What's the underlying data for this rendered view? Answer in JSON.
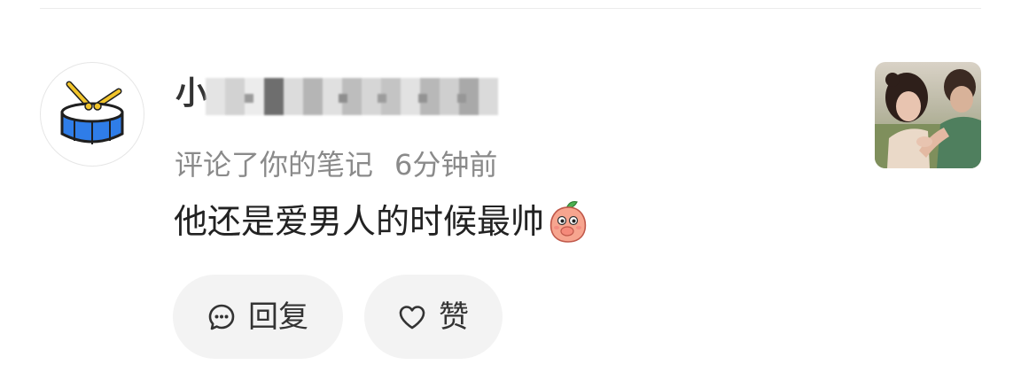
{
  "notification": {
    "username": "小",
    "action": "评论了你的笔记",
    "time": "6分钟前",
    "comment": "他还是爱男人的时候最帅",
    "avatar_icon": "drum-icon",
    "emoji_icon": "peach-emoji-icon"
  },
  "buttons": {
    "reply_label": "回复",
    "reply_icon": "comment-bubble-icon",
    "like_label": "赞",
    "like_icon": "heart-icon"
  },
  "colors": {
    "drum_body": "#2f7de8",
    "drum_sticks": "#f2c52b",
    "button_bg": "#f3f3f3",
    "meta_text": "#8a8a8a"
  }
}
